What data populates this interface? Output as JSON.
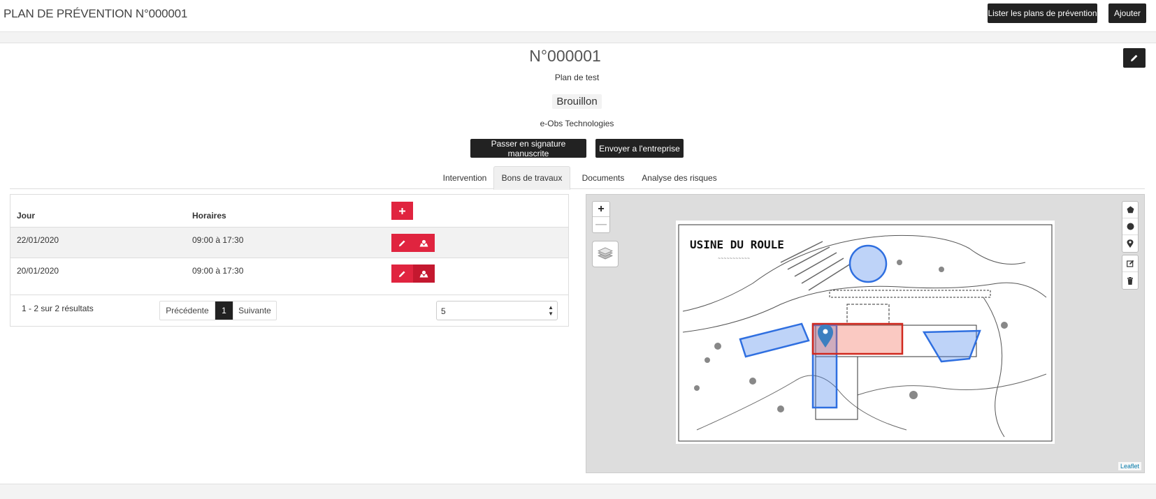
{
  "header": {
    "title": "PLAN DE PRÉVENTION N°000001",
    "list_button": "Lister les plans de prévention",
    "add_button": "Ajouter"
  },
  "plan": {
    "number": "N°000001",
    "label": "Plan de test",
    "status": "Brouillon",
    "company": "e-Obs Technologies",
    "sign_button": "Passer en signature manuscrite",
    "send_button": "Envoyer a l'entreprise"
  },
  "tabs": [
    {
      "label": "Intervention"
    },
    {
      "label": "Bons de travaux",
      "active": true
    },
    {
      "label": "Documents"
    },
    {
      "label": "Analyse des risques"
    }
  ],
  "table": {
    "headers": [
      "Jour",
      "Horaires"
    ],
    "rows": [
      {
        "jour": "22/01/2020",
        "horaires": "09:00 à 17:30"
      },
      {
        "jour": "20/01/2020",
        "horaires": "09:00 à 17:30"
      }
    ],
    "results": "1 - 2 sur 2 résultats",
    "pagination": {
      "previous": "Précédente",
      "current": "1",
      "next": "Suivante"
    },
    "page_size": "5"
  },
  "map": {
    "zoom_in": "+",
    "zoom_out": "—",
    "attribution": "Leaflet",
    "plan_title": "USINE DU ROULE"
  },
  "colors": {
    "accent_red": "#e0243f",
    "dark": "#222222",
    "zone_blue": "#2f6fe0",
    "zone_red": "#d0281e"
  }
}
